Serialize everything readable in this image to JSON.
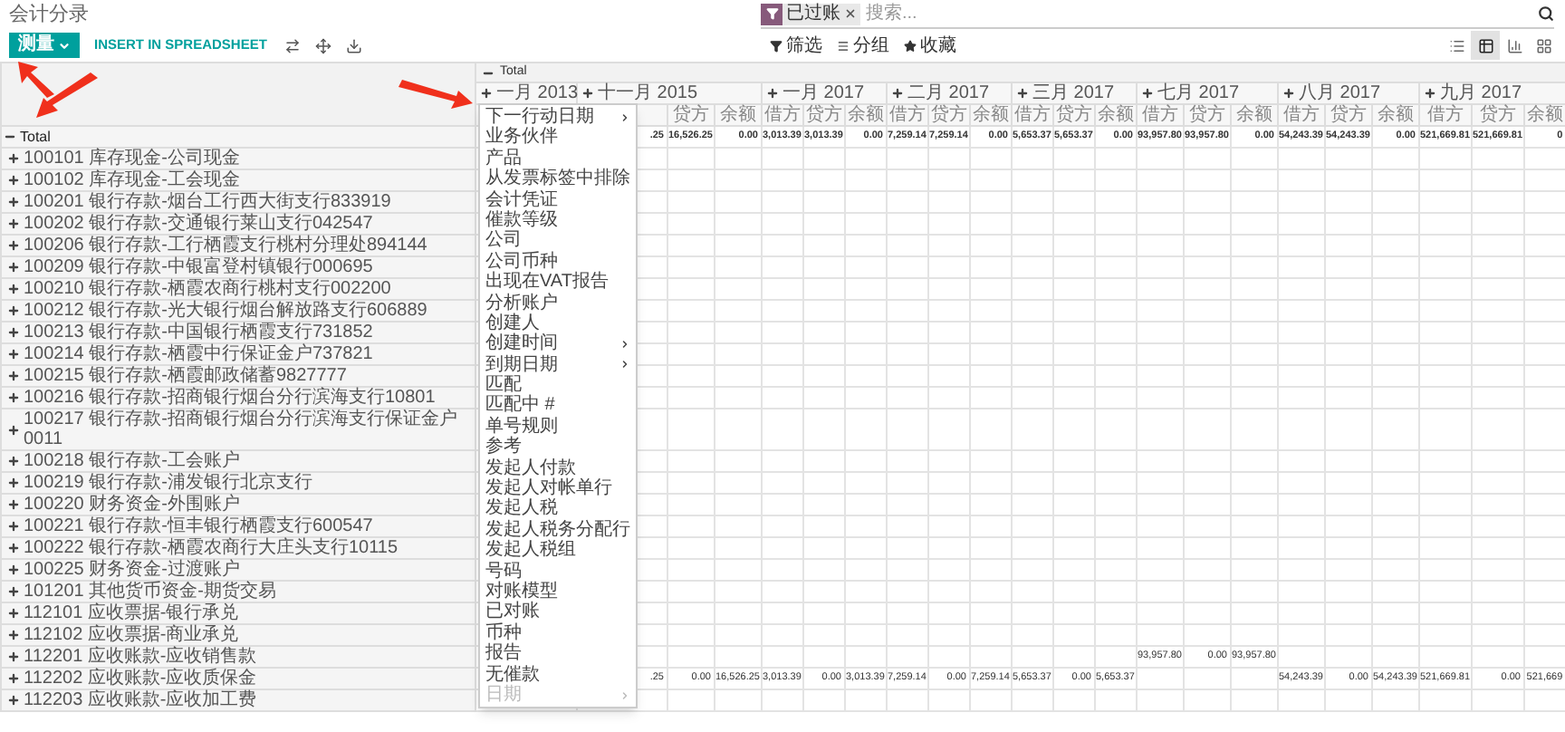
{
  "title": "会计分录",
  "search": {
    "facets": [
      {
        "label": "已过账"
      }
    ],
    "placeholder": "搜索..."
  },
  "toolbar": {
    "measure_button": "测量",
    "insert_button": "INSERT IN SPREADSHEET"
  },
  "filters": [
    "筛选",
    "分组",
    "收藏"
  ],
  "views": [
    {
      "selected": false
    },
    {
      "selected": true
    },
    {
      "selected": false
    },
    {
      "selected": false
    }
  ],
  "pivot": {
    "column_header": {
      "label": "Total",
      "expanded": true
    },
    "groups": [
      {
        "label": "一月 2013",
        "expanded": false
      },
      {
        "label": "十一月 2015",
        "expanded": false,
        "measures": [
          "贷方",
          "余额"
        ]
      },
      {
        "label": "一月 2017",
        "expanded": false,
        "measures": [
          "借方",
          "贷方",
          "余额"
        ]
      },
      {
        "label": "二月 2017",
        "expanded": false,
        "measures": [
          "借方",
          "贷方",
          "余额"
        ]
      },
      {
        "label": "三月 2017",
        "expanded": false,
        "measures": [
          "借方",
          "贷方",
          "余额"
        ]
      },
      {
        "label": "七月 2017",
        "expanded": false,
        "measures": [
          "借方",
          "贷方",
          "余额"
        ]
      },
      {
        "label": "八月 2017",
        "expanded": false,
        "measures": [
          "借方",
          "贷方",
          "余额"
        ]
      },
      {
        "label": "九月 2017",
        "expanded": false,
        "measures": [
          "借方",
          "贷方",
          "余额"
        ]
      }
    ],
    "rows": [
      {
        "kind": "total",
        "label": "Total",
        "expanded": true,
        "values": {
          "column_1": ".25",
          "column_2": "16,526.25",
          "column_3": "0.00",
          "column_4": "3,013.39",
          "column_5": "3,013.39",
          "column_6": "0.00",
          "column_7": "7,259.14",
          "column_8": "7,259.14",
          "column_9": "0.00",
          "column_10": "5,653.37",
          "column_11": "5,653.37",
          "column_12": "0.00",
          "column_13": "93,957.80",
          "column_14": "93,957.80",
          "column_15": "0.00",
          "column_16": "54,243.39",
          "column_17": "54,243.39",
          "column_18": "0.00",
          "column_19": "521,669.81",
          "column_20": "521,669.81",
          "column_21": "0"
        }
      },
      {
        "kind": "account",
        "label": "100101 库存现金-公司现金",
        "expanded": false
      },
      {
        "kind": "account",
        "label": "100102 库存现金-工会现金",
        "expanded": false
      },
      {
        "kind": "account",
        "label": "100201 银行存款-烟台工行西大街支行833919",
        "expanded": false
      },
      {
        "kind": "account",
        "label": "100202 银行存款-交通银行莱山支行042547",
        "expanded": false
      },
      {
        "kind": "account",
        "label": "100206 银行存款-工行栖霞支行桃村分理处894144",
        "expanded": false
      },
      {
        "kind": "account",
        "label": "100209 银行存款-中银富登村镇银行000695",
        "expanded": false
      },
      {
        "kind": "account",
        "label": "100210 银行存款-栖霞农商行桃村支行002200",
        "expanded": false
      },
      {
        "kind": "account",
        "label": "100212 银行存款-光大银行烟台解放路支行606889",
        "expanded": false
      },
      {
        "kind": "account",
        "label": "100213 银行存款-中国银行栖霞支行731852",
        "expanded": false
      },
      {
        "kind": "account",
        "label": "100214 银行存款-栖霞中行保证金户737821",
        "expanded": false
      },
      {
        "kind": "account",
        "label": "100215 银行存款-栖霞邮政储蓄9827777",
        "expanded": false
      },
      {
        "kind": "account",
        "label": "100216 银行存款-招商银行烟台分行滨海支行10801",
        "expanded": false
      },
      {
        "kind": "account",
        "label": "100217 银行存款-招商银行烟台分行滨海支行保证金户0011",
        "expanded": false
      },
      {
        "kind": "account",
        "label": "100218 银行存款-工会账户",
        "expanded": false
      },
      {
        "kind": "account",
        "label": "100219 银行存款-浦发银行北京支行",
        "expanded": false
      },
      {
        "kind": "account",
        "label": "100220 财务资金-外围账户",
        "expanded": false
      },
      {
        "kind": "account",
        "label": "100221 银行存款-恒丰银行栖霞支行600547",
        "expanded": false
      },
      {
        "kind": "account",
        "label": "100222 银行存款-栖霞农商行大庄头支行10115",
        "expanded": false
      },
      {
        "kind": "account",
        "label": "100225 财务资金-过渡账户",
        "expanded": false
      },
      {
        "kind": "account",
        "label": "101201 其他货币资金-期货交易",
        "expanded": false
      },
      {
        "kind": "account",
        "label": "112101 应收票据-银行承兑",
        "expanded": false
      },
      {
        "kind": "account",
        "label": "112102 应收票据-商业承兑",
        "expanded": false
      },
      {
        "kind": "account",
        "label": "112201 应收账款-应收销售款",
        "expanded": false,
        "values": {
          "column_13": "93,957.80",
          "column_14": "0.00",
          "column_15": "93,957.80"
        }
      },
      {
        "kind": "account",
        "label": "112202 应收账款-应收质保金",
        "expanded": false,
        "values": {
          "column_1": ".25",
          "column_2": "0.00",
          "column_3": "16,526.25",
          "column_4": "3,013.39",
          "column_5": "0.00",
          "column_6": "3,013.39",
          "column_7": "7,259.14",
          "column_8": "0.00",
          "column_9": "7,259.14",
          "column_10": "5,653.37",
          "column_11": "0.00",
          "column_12": "5,653.37",
          "column_16": "54,243.39",
          "column_17": "0.00",
          "column_18": "54,243.39",
          "column_19": "521,669.81",
          "column_20": "0.00",
          "column_21": "521,669"
        }
      },
      {
        "kind": "account",
        "label": "112203 应收账款-应收加工费",
        "expanded": false
      }
    ]
  },
  "group_by_menu": {
    "items": [
      {
        "label": "下一行动日期",
        "submenu": true,
        "disabled": false
      },
      {
        "label": "业务伙伴",
        "submenu": false,
        "disabled": false
      },
      {
        "label": "产品",
        "submenu": false,
        "disabled": false
      },
      {
        "label": "从发票标签中排除",
        "submenu": false,
        "disabled": false
      },
      {
        "label": "会计凭证",
        "submenu": false,
        "disabled": false
      },
      {
        "label": "催款等级",
        "submenu": false,
        "disabled": false
      },
      {
        "label": "公司",
        "submenu": false,
        "disabled": false
      },
      {
        "label": "公司币种",
        "submenu": false,
        "disabled": false
      },
      {
        "label": "出现在VAT报告",
        "submenu": false,
        "disabled": false
      },
      {
        "label": "分析账户",
        "submenu": false,
        "disabled": false
      },
      {
        "label": "创建人",
        "submenu": false,
        "disabled": false
      },
      {
        "label": "创建时间",
        "submenu": true,
        "disabled": false
      },
      {
        "label": "到期日期",
        "submenu": true,
        "disabled": false
      },
      {
        "label": "匹配",
        "submenu": false,
        "disabled": false
      },
      {
        "label": "匹配中 #",
        "submenu": false,
        "disabled": false
      },
      {
        "label": "单号规则",
        "submenu": false,
        "disabled": false
      },
      {
        "label": "参考",
        "submenu": false,
        "disabled": false
      },
      {
        "label": "发起人付款",
        "submenu": false,
        "disabled": false
      },
      {
        "label": "发起人对帐单行",
        "submenu": false,
        "disabled": false
      },
      {
        "label": "发起人税",
        "submenu": false,
        "disabled": false
      },
      {
        "label": "发起人税务分配行",
        "submenu": false,
        "disabled": false
      },
      {
        "label": "发起人税组",
        "submenu": false,
        "disabled": false
      },
      {
        "label": "号码",
        "submenu": false,
        "disabled": false
      },
      {
        "label": "对账模型",
        "submenu": false,
        "disabled": false
      },
      {
        "label": "已对账",
        "submenu": false,
        "disabled": false
      },
      {
        "label": "币种",
        "submenu": false,
        "disabled": false
      },
      {
        "label": "报告",
        "submenu": false,
        "disabled": false
      },
      {
        "label": "无催款",
        "submenu": false,
        "disabled": false
      },
      {
        "label": "日期",
        "submenu": true,
        "disabled": true
      }
    ]
  }
}
